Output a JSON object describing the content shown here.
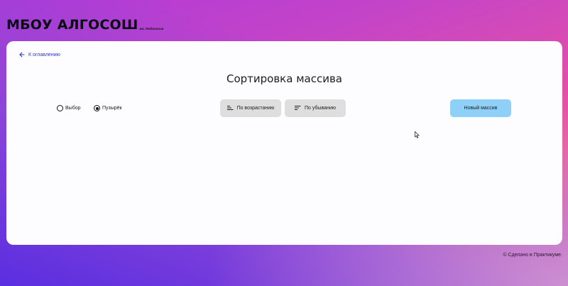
{
  "header": {
    "logo": "МБОУ АЛГОСОШ",
    "logo_sub": "им. Фибоначчи"
  },
  "nav": {
    "back_label": "К оглавлению",
    "back_icon": "arrow-left-icon"
  },
  "page": {
    "title": "Сортировка массива"
  },
  "sort_method": {
    "options": [
      {
        "label": "Выбор",
        "selected": false
      },
      {
        "label": "Пузырёк",
        "selected": true
      }
    ]
  },
  "buttons": {
    "ascending": {
      "label": "По возрастанию",
      "icon": "sort-ascending-icon"
    },
    "descending": {
      "label": "По убыванию",
      "icon": "sort-descending-icon"
    },
    "new_array": {
      "label": "Новый массив"
    }
  },
  "footer": {
    "text": "© Сделано в Практикуме."
  },
  "colors": {
    "accent_link": "#2a3bc0",
    "primary_button": "#8fd0f8",
    "secondary_button": "#dedede",
    "card_background": "#fdfcff"
  }
}
